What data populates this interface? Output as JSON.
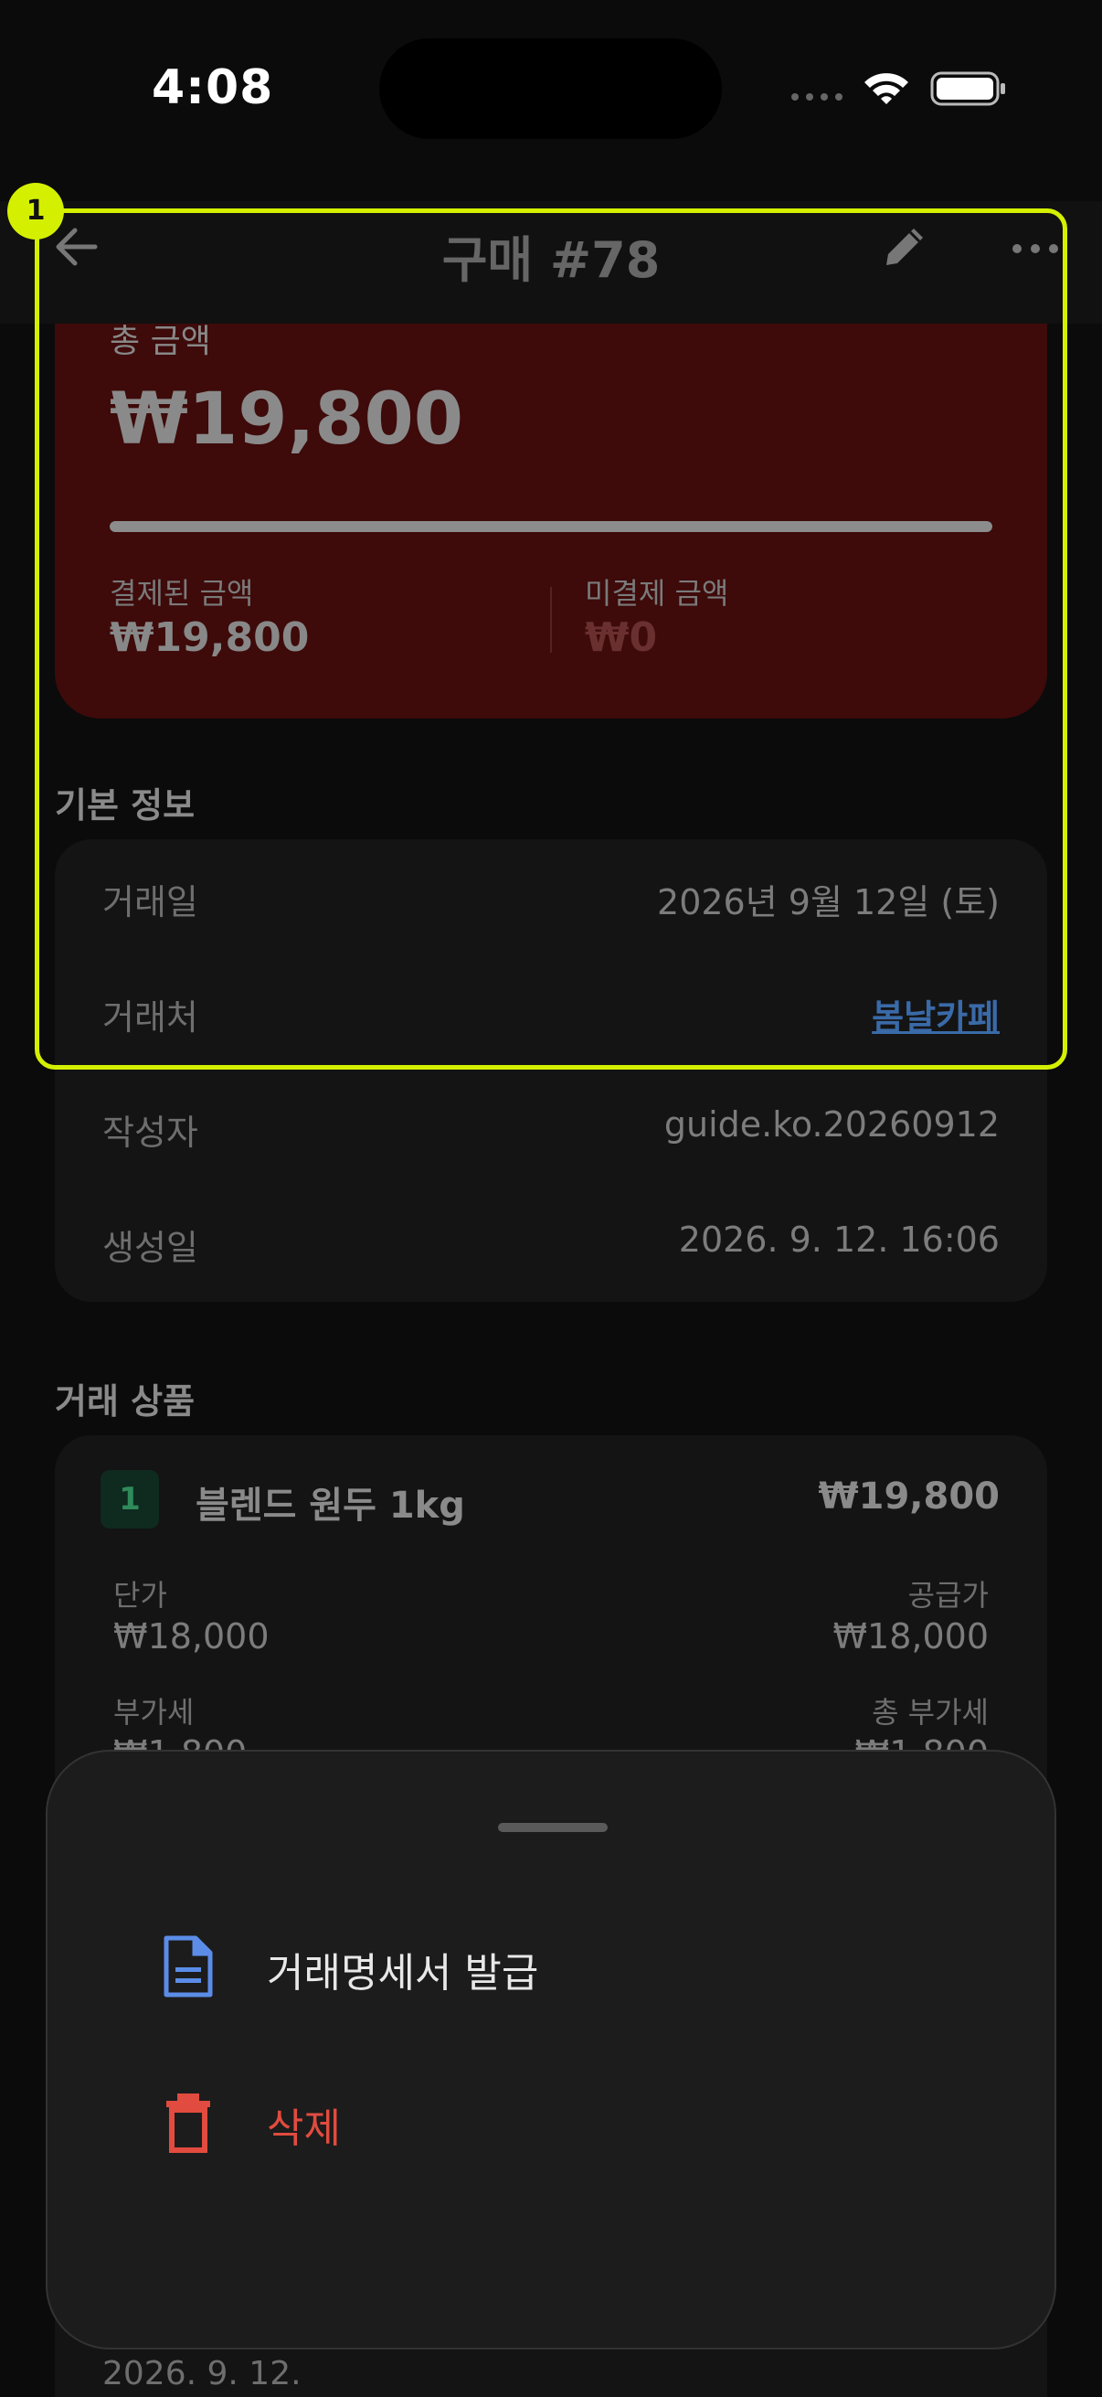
{
  "status_bar": {
    "time": "4:08"
  },
  "nav": {
    "title": "구매 #78"
  },
  "summary": {
    "total_label": "총 금액",
    "total_amount": "₩19,800",
    "paid_fraction": 1.0,
    "paid_label": "결제된 금액",
    "paid_value": "₩19,800",
    "unpaid_label": "미결제 금액",
    "unpaid_value": "₩0"
  },
  "basic_info": {
    "title": "기본 정보",
    "rows": [
      {
        "label": "거래일",
        "value": "2026년 9월 12일 (토)"
      },
      {
        "label": "거래처",
        "value": "봄날카페"
      },
      {
        "label": "작성자",
        "value": "guide.ko.20260912"
      },
      {
        "label": "생성일",
        "value": "2026. 9. 12. 16:06"
      }
    ]
  },
  "items": {
    "title": "거래 상품",
    "list": [
      {
        "index": "1",
        "name": "블렌드 원두 1kg",
        "total": "₩19,800",
        "unit_price_label": "단가",
        "unit_price": "₩18,000",
        "supply_label": "공급가",
        "supply": "₩18,000",
        "vat_label": "부가세",
        "vat": "₩1,800",
        "total_vat_label": "총 부가세",
        "total_vat": "₩1,800"
      }
    ]
  },
  "footer_date": "2026. 9. 12.",
  "annotation": {
    "badge": "1"
  },
  "sheet": {
    "items": [
      {
        "label": "거래명세서 발급",
        "icon": "document-icon",
        "color": "#e8e8e8"
      },
      {
        "label": "삭제",
        "icon": "trash-icon",
        "color": "#e24b3f"
      }
    ]
  },
  "colors": {
    "background": "#0b0b0b",
    "card_red": "#3e0a0a",
    "highlight": "#d4f000",
    "link": "#3a6aa8",
    "danger": "#e24b3f",
    "document_icon": "#5b8de8"
  }
}
